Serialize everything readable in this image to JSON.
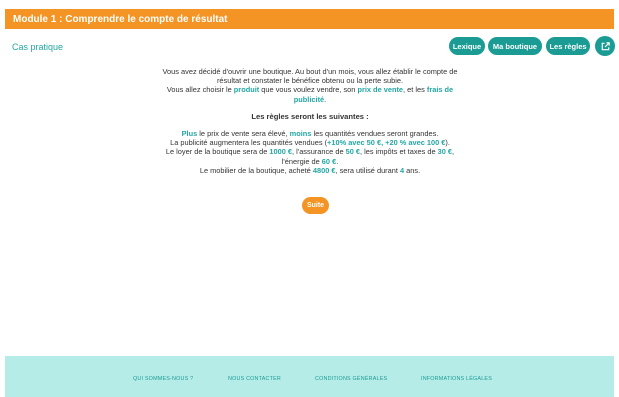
{
  "header": {
    "title": "Module 1 : Comprendre le compte de résultat"
  },
  "subheader": {
    "title": "Cas pratique",
    "buttons": {
      "lexique": "Lexique",
      "boutique": "Ma boutique",
      "regles": "Les règles"
    }
  },
  "content": {
    "p1a": "Vous avez décidé d'ouvrir une boutique. Au bout d'un mois, vous allez établir le compte de résultat et constater le bénéfice obtenu ou la perte subie.",
    "p1b_1": "Vous allez choisir le ",
    "p1b_produit": "produit",
    "p1b_2": " que vous voulez vendre, son ",
    "p1b_prix": "prix de vente",
    "p1b_3": ", et les ",
    "p1b_frais": "frais de publicité",
    "p1b_4": ".",
    "rules_title": "Les règles seront les suivantes :",
    "r1_plus": "Plus",
    "r1_a": " le prix de vente sera élevé, ",
    "r1_moins": "moins",
    "r1_b": " les quantités vendues seront grandes.",
    "r2_a": "La publicité augmentera les quantités vendues (",
    "r2_hl": "+10% avec 50 €, +20 % avec 100 €",
    "r2_b": ").",
    "r3_a": "Le loyer de la boutique sera de ",
    "r3_loyer": "1000 €",
    "r3_b": ", l'assurance de ",
    "r3_assur": "50 €",
    "r3_c": ", les impôts et taxes de ",
    "r3_impots": "30 €",
    "r3_d": ", l'énergie de ",
    "r3_energie": "60 €",
    "r3_e": ".",
    "r4_a": "Le mobilier de la boutique, acheté ",
    "r4_prix": "4800 €",
    "r4_b": ", sera utilisé durant ",
    "r4_ans": "4",
    "r4_c": " ans."
  },
  "suite_label": "Suite",
  "footer": {
    "links": [
      "QUI SOMMES-NOUS ?",
      "NOUS CONTACTER",
      "CONDITIONS GÉNÉRALES",
      "INFORMATIONS LÉGALES"
    ]
  },
  "colors": {
    "orange": "#f39424",
    "teal": "#1a9b93",
    "footer_bg": "#b5ece8"
  },
  "icons": {
    "external": "external-link-icon"
  }
}
